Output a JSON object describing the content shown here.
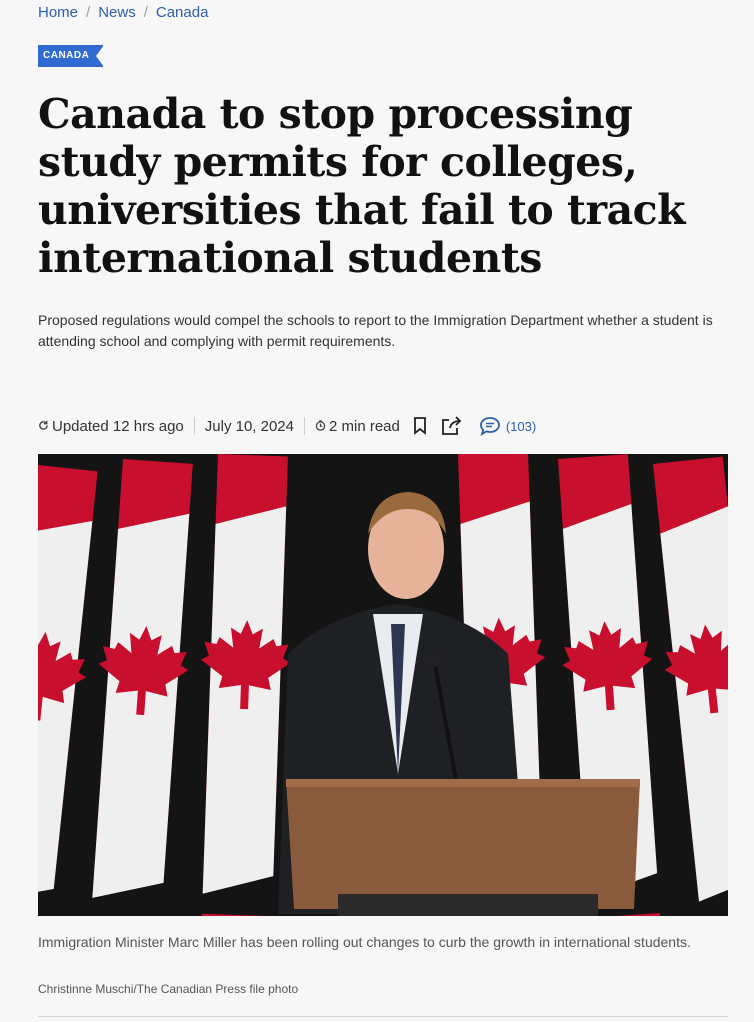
{
  "breadcrumb": {
    "items": [
      "Home",
      "News",
      "Canada"
    ],
    "separator": "/"
  },
  "section_tag": "CANADA",
  "headline": "Canada to stop processing study permits for colleges, universities that fail to track international students",
  "dek": "Proposed regulations would compel the schools to report to the Immigration Department whether a student is attending school and complying with permit requirements.",
  "meta": {
    "updated": "Updated 12 hrs ago",
    "date": "July 10, 2024",
    "read_time": "2 min read",
    "comment_count": "(103)",
    "icons": [
      "refresh-icon",
      "clock-icon",
      "bookmark-icon",
      "share-icon",
      "comment-icon"
    ]
  },
  "photo": {
    "caption": "Immigration Minister Marc Miller has been rolling out changes to curb the growth in international students.",
    "credit": "Christinne Muschi/The Canadian Press file photo"
  },
  "colors": {
    "accent": "#2f6bd0",
    "link": "#2c5fa8",
    "flag_red": "#c8102e"
  }
}
